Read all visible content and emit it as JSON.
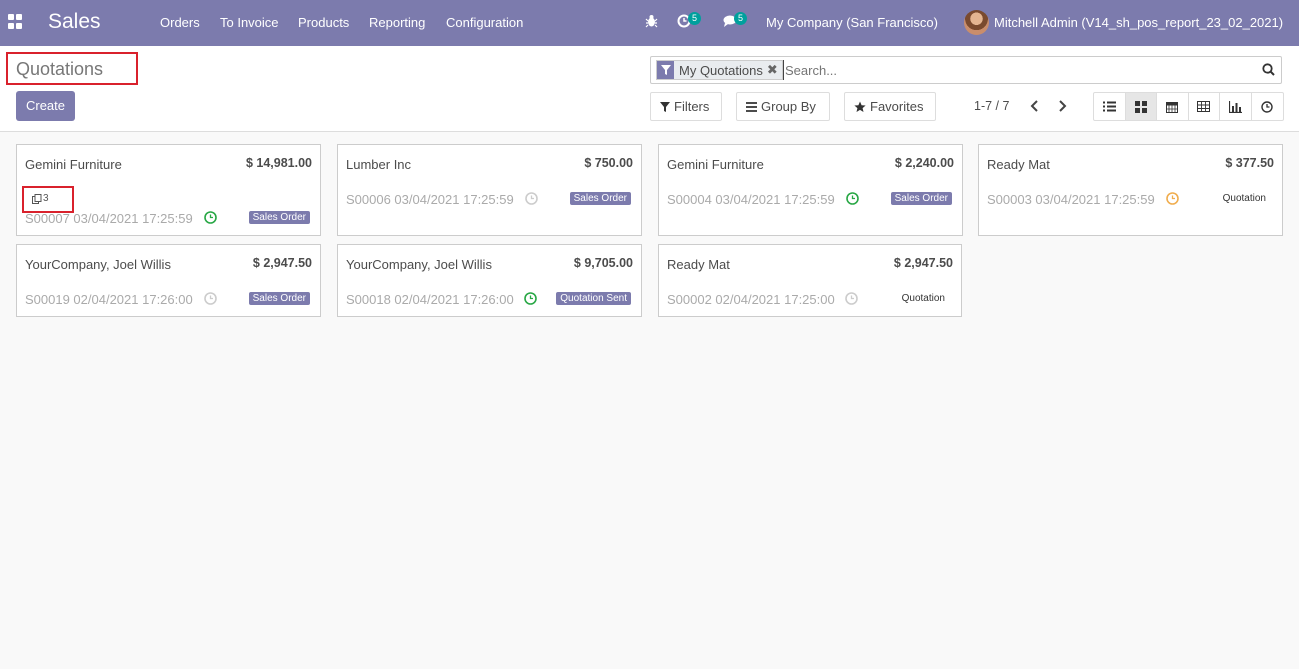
{
  "navbar": {
    "brand": "Sales",
    "menu": [
      "Orders",
      "To Invoice",
      "Products",
      "Reporting",
      "Configuration"
    ],
    "activity_count": "5",
    "messages_count": "5",
    "company": "My Company (San Francisco)",
    "user": "Mitchell Admin (V14_sh_pos_report_23_02_2021)"
  },
  "control": {
    "title": "Quotations",
    "create_label": "Create",
    "facet_label": "My Quotations",
    "search_placeholder": "Search...",
    "filters_label": "Filters",
    "groupby_label": "Group By",
    "favorites_label": "Favorites",
    "pager": "1-7 / 7"
  },
  "cards": [
    {
      "name": "Gemini Furniture",
      "amount": "$ 14,981.00",
      "ref": "S00007 03/04/2021 17:25:59",
      "status": "Sales Order",
      "activity": "green",
      "attachments": "3"
    },
    {
      "name": "Lumber Inc",
      "amount": "$ 750.00",
      "ref": "S00006 03/04/2021 17:25:59",
      "status": "Sales Order",
      "activity": "grey"
    },
    {
      "name": "Gemini Furniture",
      "amount": "$ 2,240.00",
      "ref": "S00004 03/04/2021 17:25:59",
      "status": "Sales Order",
      "activity": "green"
    },
    {
      "name": "Ready Mat",
      "amount": "$ 377.50",
      "ref": "S00003 03/04/2021 17:25:59",
      "status": "Quotation",
      "activity": "orange"
    },
    {
      "name": "YourCompany, Joel Willis",
      "amount": "$ 2,947.50",
      "ref": "S00019 02/04/2021 17:26:00",
      "status": "Sales Order",
      "activity": "grey"
    },
    {
      "name": "YourCompany, Joel Willis",
      "amount": "$ 9,705.00",
      "ref": "S00018 02/04/2021 17:26:00",
      "status": "Quotation Sent",
      "activity": "green"
    },
    {
      "name": "Ready Mat",
      "amount": "$ 2,947.50",
      "ref": "S00002 02/04/2021 17:25:00",
      "status": "Quotation",
      "activity": "grey"
    }
  ],
  "colors": {
    "brand": "#7c7bad",
    "highlight": "#d9212c",
    "activity_green": "#28a745",
    "activity_orange": "#f0ad4e",
    "activity_grey": "#cccccc"
  }
}
